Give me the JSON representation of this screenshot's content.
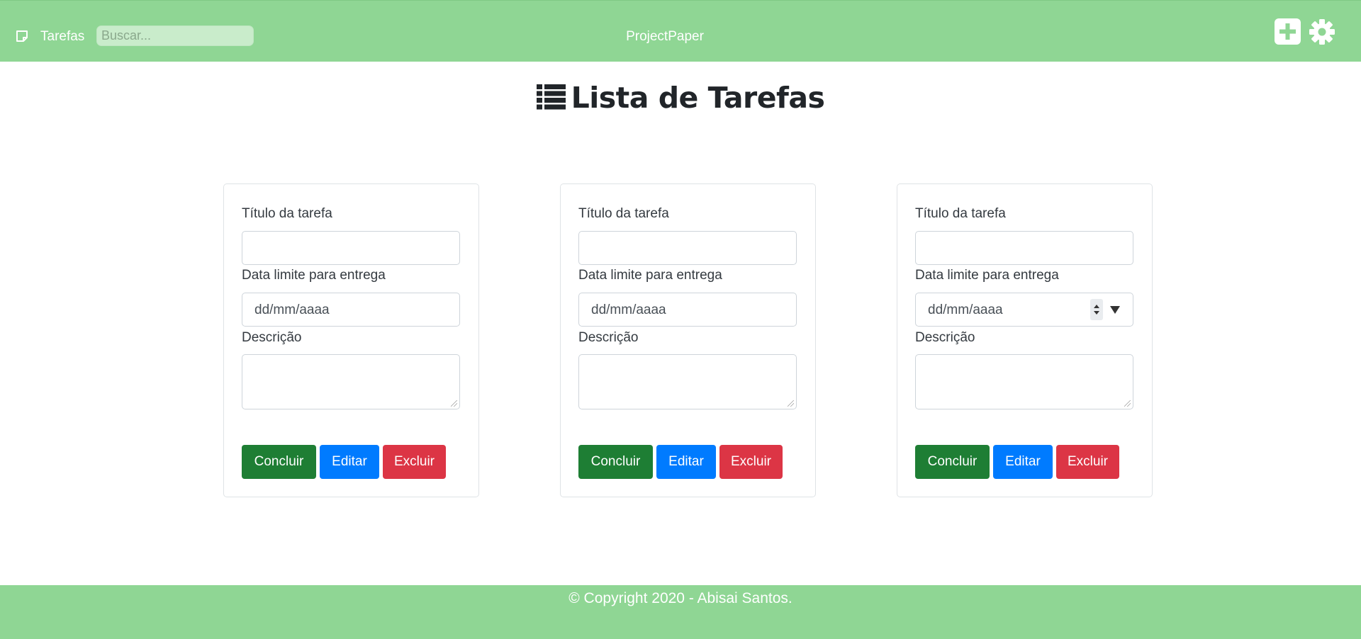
{
  "header": {
    "brand_label": "Tarefas",
    "search_placeholder": "Buscar...",
    "app_title": "ProjectPaper",
    "icons": {
      "brand": "note-icon",
      "add": "plus-square-icon",
      "settings": "gear-icon"
    },
    "background_color": "#8fd694"
  },
  "page": {
    "title": "Lista de Tarefas",
    "title_icon": "list-icon"
  },
  "cards": [
    {
      "title_label": "Título da tarefa",
      "title_value": "",
      "date_label": "Data limite para entrega",
      "date_placeholder": "dd/mm/aaaa",
      "description_label": "Descrição",
      "description_value": "",
      "buttons": {
        "conclude": "Concluir",
        "edit": "Editar",
        "delete": "Excluir"
      }
    },
    {
      "title_label": "Título da tarefa",
      "title_value": "",
      "date_label": "Data limite para entrega",
      "date_placeholder": "dd/mm/aaaa",
      "description_label": "Descrição",
      "description_value": "",
      "buttons": {
        "conclude": "Concluir",
        "edit": "Editar",
        "delete": "Excluir"
      }
    },
    {
      "title_label": "Título da tarefa",
      "title_value": "",
      "date_label": "Data limite para entrega",
      "date_placeholder": "dd/mm/aaaa",
      "description_label": "Descrição",
      "description_value": "",
      "buttons": {
        "conclude": "Concluir",
        "edit": "Editar",
        "delete": "Excluir"
      }
    }
  ],
  "colors": {
    "conclude": "#1e7e34",
    "edit": "#007bff",
    "delete": "#dc3545"
  },
  "footer": {
    "text": "© Copyright 2020 - Abisai Santos."
  }
}
